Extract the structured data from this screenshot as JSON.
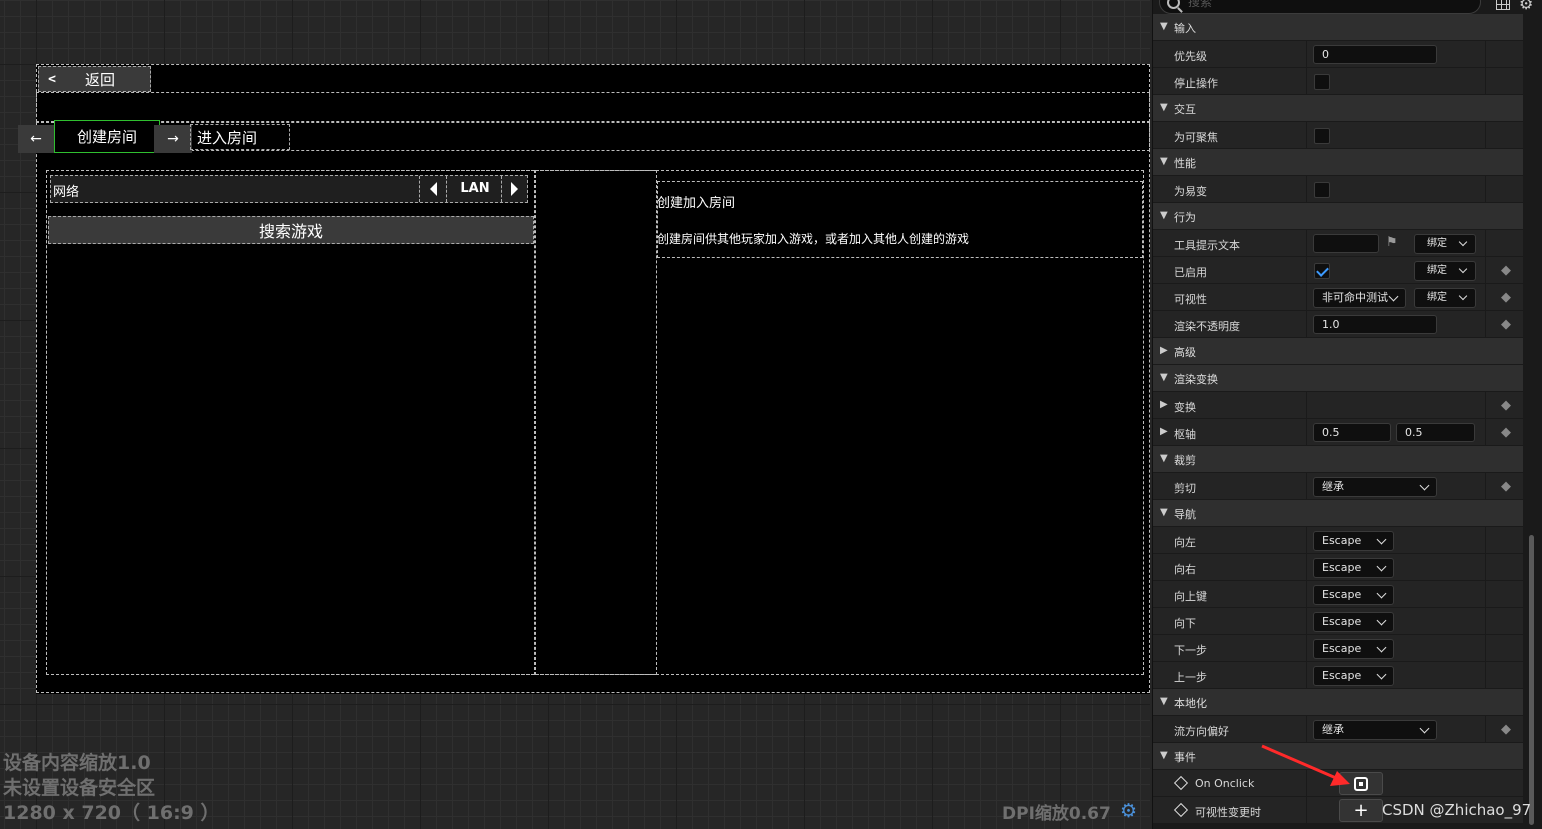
{
  "canvas": {
    "back_chevron": "<",
    "back_label": "返回",
    "tab_left": "←",
    "tab_create": "创建房间",
    "tab_right": "→",
    "tab_join": "进入房间",
    "network_label": "网络",
    "network_value": "LAN",
    "search_game": "搜索游戏",
    "info_title": "创建加入房间",
    "info_desc": "创建房间供其他玩家加入游戏，或者加入其他人创建的游戏",
    "overlay_line1": "设备内容缩放1.0",
    "overlay_line2": "未设置设备安全区",
    "overlay_line3": "1280 x 720（ 16:9 ）",
    "dpi": "DPI缩放0.67"
  },
  "panel": {
    "search_placeholder": "搜索",
    "cat_input": "输入",
    "priority_label": "优先级",
    "priority_value": "0",
    "stop_action_label": "停止操作",
    "cat_interaction": "交互",
    "focusable_label": "为可聚焦",
    "cat_performance": "性能",
    "volatile_label": "为易变",
    "cat_behavior": "行为",
    "tooltip_label": "工具提示文本",
    "bind_label": "绑定",
    "enabled_label": "已启用",
    "visibility_label": "可视性",
    "visibility_value": "非可命中测试",
    "opacity_label": "渲染不透明度",
    "opacity_value": "1.0",
    "cat_advanced": "高级",
    "cat_render_transform": "渲染变换",
    "transform_label": "变换",
    "pivot_label": "枢轴",
    "pivot_x": "0.5",
    "pivot_y": "0.5",
    "cat_clipping": "裁剪",
    "clipping_label": "剪切",
    "clipping_value": "继承",
    "cat_navigation": "导航",
    "nav_left_label": "向左",
    "nav_right_label": "向右",
    "nav_up_label": "向上键",
    "nav_down_label": "向下",
    "nav_next_label": "下一步",
    "nav_prev_label": "上一步",
    "nav_value": "Escape",
    "cat_localization": "本地化",
    "flow_label": "流方向偏好",
    "flow_value": "继承",
    "cat_events": "事件",
    "on_onclick_label": "On Onclick",
    "vis_changed_label": "可视性变更时",
    "add_symbol": "+"
  },
  "watermark": "CSDN @Zhichao_97"
}
